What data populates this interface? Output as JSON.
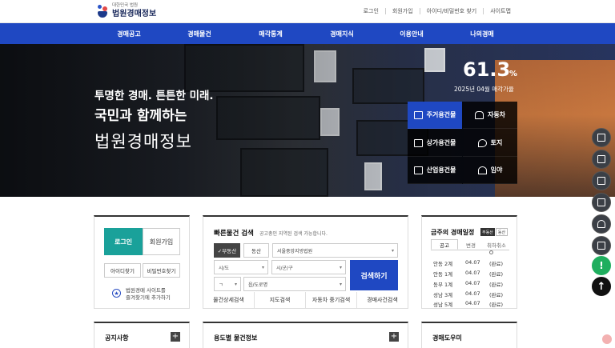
{
  "logo": {
    "sub": "대한민국 법원",
    "main": "법원경매정보"
  },
  "util_nav": [
    "로그인",
    "회원가입",
    "아이디/비밀번호 찾기",
    "사이트맵"
  ],
  "main_nav": [
    "경매공고",
    "경매물건",
    "매각통계",
    "경매지식",
    "이용안내",
    "나의경매"
  ],
  "hero": {
    "line1": "투명한 경매. 튼튼한 미래.",
    "line2": "국민과 함께하는",
    "line3": "법원경매정보",
    "stat_value": "61.3",
    "stat_unit": "%",
    "stat_caption": "2025년 04월 매각가율"
  },
  "categories": [
    {
      "label": "주거용건물",
      "icon": "house-icon"
    },
    {
      "label": "자동차",
      "icon": "car-icon"
    },
    {
      "label": "상가용건물",
      "icon": "store-icon"
    },
    {
      "label": "토지",
      "icon": "land-pin-icon"
    },
    {
      "label": "산업용건물",
      "icon": "factory-icon"
    },
    {
      "label": "임야",
      "icon": "forest-icon"
    }
  ],
  "login_panel": {
    "login": "로그인",
    "join": "회원가입",
    "find_id": "아이디찾기",
    "find_pw": "비밀번호찾기",
    "fav_line1": "법원경매 사이트를",
    "fav_line2": "즐겨찾기에 추가하기"
  },
  "search_panel": {
    "title": "빠른물건 검색",
    "desc": "공고총인 지역된 검색 가능합니다.",
    "chip_real": "✓부동산",
    "chip_movable": "동산",
    "court": "서울중앙지방법원",
    "sido": "시/도",
    "sigungu": "시/군/구",
    "initial": "ㄱ",
    "dong": "읍/도로명",
    "search_btn": "검색하기",
    "links": [
      "물건상세검색",
      "지도검색",
      "자동차 중기검색",
      "경매사건검색"
    ]
  },
  "schedule_panel": {
    "title": "금주의 경매일정",
    "badge_real": "부동산",
    "badge_movable": "동산",
    "tabs": [
      "공고",
      "변경",
      "취하취소"
    ],
    "rows": [
      {
        "place": "안동 2계",
        "date": "04.07",
        "status": "(완료)"
      },
      {
        "place": "안동 1계",
        "date": "04.07",
        "status": "(완료)"
      },
      {
        "place": "동부 1계",
        "date": "04.07",
        "status": "(완료)"
      },
      {
        "place": "성남 3계",
        "date": "04.07",
        "status": "(완료)"
      },
      {
        "place": "성남 5계",
        "date": "04.07",
        "status": "(완료)"
      }
    ]
  },
  "lower_panels": {
    "notice": "공지사항",
    "usage": "용도별 물건정보",
    "help": "경매도우미",
    "plus": "+"
  },
  "floating": {
    "alert": "!",
    "top": "↑"
  },
  "colors": {
    "brand_blue": "#1f48c2",
    "login_teal": "#1aa19a"
  }
}
